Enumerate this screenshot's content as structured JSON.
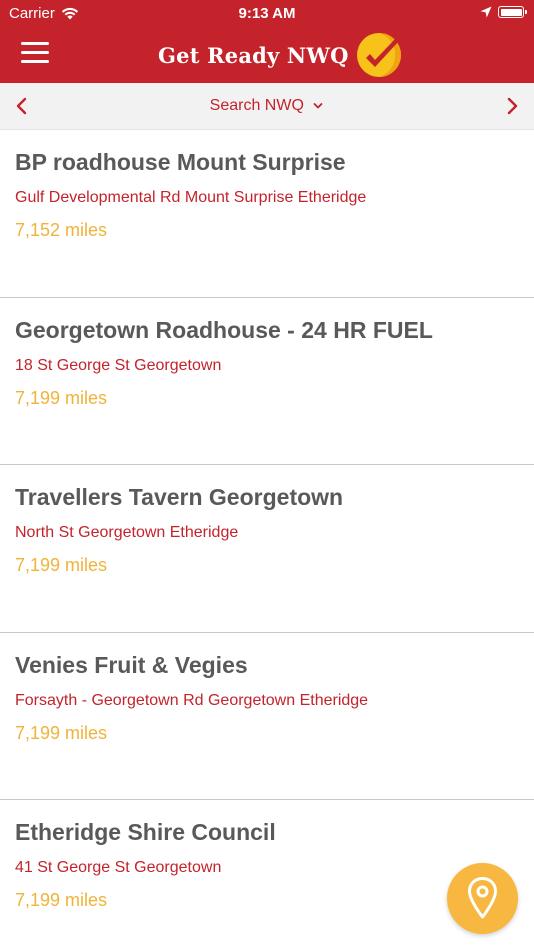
{
  "status_bar": {
    "carrier": "Carrier",
    "time": "9:13 AM"
  },
  "header": {
    "title": "Get Ready NWQ",
    "menu_icon": "hamburger-menu-icon",
    "logo_icon": "sun-check-logo"
  },
  "subnav": {
    "title": "Search NWQ",
    "prev_icon": "chevron-left-icon",
    "next_icon": "chevron-right-icon",
    "dropdown_icon": "chevron-down-icon"
  },
  "locations": [
    {
      "name": "BP roadhouse Mount Surprise",
      "address": "Gulf Developmental Rd Mount Surprise Etheridge",
      "distance": "7,152 miles"
    },
    {
      "name": "Georgetown Roadhouse - 24 HR FUEL",
      "address": "18 St George St Georgetown",
      "distance": "7,199 miles"
    },
    {
      "name": "Travellers Tavern Georgetown",
      "address": "North St Georgetown Etheridge",
      "distance": "7,199 miles"
    },
    {
      "name": "Venies Fruit & Vegies",
      "address": "Forsayth - Georgetown Rd Georgetown Etheridge",
      "distance": "7,199 miles"
    },
    {
      "name": "Etheridge Shire Council",
      "address": "41 St George St Georgetown",
      "distance": "7,199 miles"
    }
  ],
  "map_button": {
    "icon": "map-pin-icon"
  },
  "colors": {
    "brand_red": "#c4232b",
    "name_gray": "#595959",
    "distance_orange": "#f0b33a",
    "fab_yellow": "#f7b740"
  }
}
